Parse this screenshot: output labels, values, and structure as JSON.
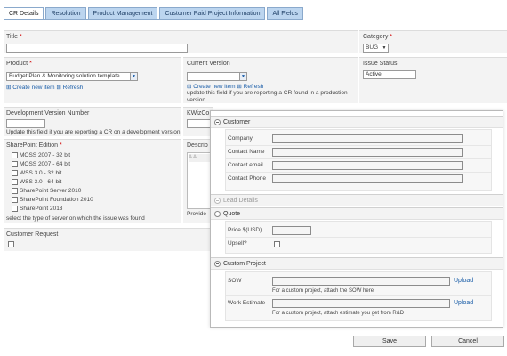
{
  "tabs": [
    "CR Details",
    "Resolution",
    "Product Management",
    "Customer Paid Project Information",
    "All Fields"
  ],
  "form": {
    "title_label": "Title",
    "req_mark": "*",
    "category_label": "Category",
    "category_value": "BUG",
    "product_label": "Product",
    "product_value": "Budget Plan & Monitoring solution template",
    "current_version_label": "Current Version",
    "create_new_item": "Create new item",
    "refresh": "Refresh",
    "current_version_hint_1": "update this field if you are reporting a CR found in a production",
    "current_version_hint_2": "version",
    "issue_status_label": "Issue Status",
    "issue_status_value": "Active",
    "dev_version_label": "Development Version Number",
    "dev_version_hint": "Update this field if you are reporting a CR on a development version",
    "kwiz_label": "KWizCo",
    "sp_edition_label": "SharePoint Edition",
    "sp_editions": [
      "MOSS 2007 - 32 bit",
      "MOSS 2007 - 64 bit",
      "WSS 3.0 - 32 bit",
      "WSS 3.0 - 64 bit",
      "SharePoint Server 2010",
      "SharePoint Foundation 2010",
      "SharePoint 2013"
    ],
    "sp_edition_hint": "select the type of server on which the issue was found",
    "descr_label": "Descrip",
    "provide_label": "Provide",
    "customer_request_label": "Customer Request"
  },
  "popup": {
    "customer_header": "Customer",
    "company_label": "Company",
    "contact_name_label": "Contact Name",
    "contact_email_label": "Contact email",
    "contact_phone_label": "Contact Phone",
    "lead_details_header": "Lead Details",
    "quote_header": "Quote",
    "price_label": "Price $(USD)",
    "upsell_label": "Upsell?",
    "custom_project_header": "Custom Project",
    "sow_label": "SOW",
    "upload_label": "Upload",
    "sow_hint": "For a custom project, attach the SOW here",
    "work_estimate_label": "Work Estimate",
    "work_estimate_hint": "For a custom project, attach estimate you get from R&D"
  },
  "buttons": {
    "save": "Save",
    "cancel": "Cancel"
  }
}
